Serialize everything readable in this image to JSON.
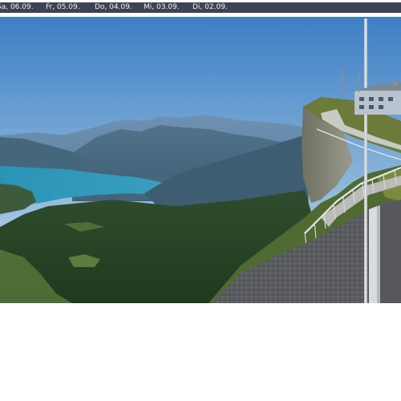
{
  "date_tabs": [
    {
      "label": "Sa, 06.09."
    },
    {
      "label": "Fr, 05.09."
    },
    {
      "label": "Do, 04.09."
    },
    {
      "label": "Mi, 03.09."
    },
    {
      "label": "Di, 02.09."
    }
  ],
  "colors": {
    "date_bar_bg": "#3c4352",
    "date_bar_text": "#f2f2f2",
    "sky_top": "#3f7fc4",
    "sky_bottom": "#c8dbea",
    "lake": "#2d8fb0",
    "forest": "#2c4a2a",
    "roof": "#5d5f63"
  }
}
